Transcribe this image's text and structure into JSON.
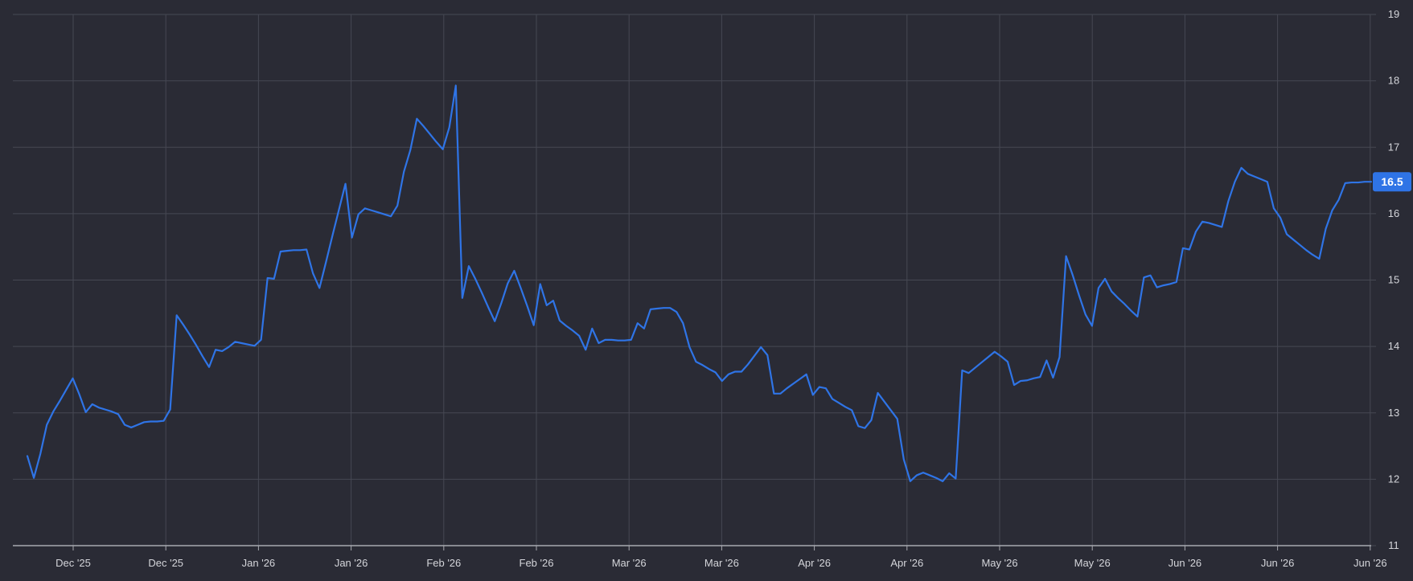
{
  "colors": {
    "background": "#2a2b35",
    "grid": "#464853",
    "axis": "#a8a9b0",
    "tick_text": "#d4d5da",
    "series": "#2f74e6",
    "badge_bg": "#2f74e6",
    "badge_text": "#ffffff"
  },
  "chart_data": {
    "type": "line",
    "title": "",
    "xlabel": "",
    "ylabel": "",
    "grid": true,
    "y_axis_position": "right",
    "ylim": [
      11,
      19
    ],
    "y_ticks": [
      11,
      12,
      13,
      14,
      15,
      16,
      17,
      18,
      19
    ],
    "x_tick_labels": [
      "Dec '25",
      "Dec '25",
      "Jan '26",
      "Jan '26",
      "Feb '26",
      "Feb '26",
      "Mar '26",
      "Mar '26",
      "Apr '26",
      "Apr '26",
      "May '26",
      "May '26",
      "Jun '26",
      "Jun '26",
      "Jun '26"
    ],
    "last_value_label": "16.5",
    "series": [
      {
        "values": [
          12.35,
          12.02,
          12.38,
          12.82,
          13.02,
          13.18,
          13.35,
          13.52,
          13.28,
          13.01,
          13.13,
          13.08,
          13.05,
          13.02,
          12.98,
          12.82,
          12.78,
          12.82,
          12.86,
          12.87,
          12.87,
          12.88,
          13.05,
          14.47,
          14.33,
          14.18,
          14.02,
          13.85,
          13.69,
          13.95,
          13.93,
          13.99,
          14.07,
          14.05,
          14.03,
          14.01,
          14.1,
          15.03,
          15.02,
          15.43,
          15.44,
          15.45,
          15.45,
          15.46,
          15.1,
          14.88,
          15.27,
          15.67,
          16.06,
          16.45,
          15.64,
          15.99,
          16.08,
          16.05,
          16.02,
          15.99,
          15.96,
          16.12,
          16.63,
          16.96,
          17.43,
          17.32,
          17.2,
          17.08,
          16.97,
          17.3,
          17.93,
          14.73,
          15.21,
          15.02,
          14.81,
          14.59,
          14.38,
          14.65,
          14.95,
          15.14,
          14.88,
          14.61,
          14.32,
          14.94,
          14.62,
          14.69,
          14.39,
          14.31,
          14.24,
          14.16,
          13.95,
          14.27,
          14.05,
          14.1,
          14.1,
          14.09,
          14.09,
          14.1,
          14.35,
          14.27,
          14.56,
          14.57,
          14.58,
          14.58,
          14.52,
          14.35,
          13.99,
          13.77,
          13.72,
          13.66,
          13.61,
          13.48,
          13.58,
          13.62,
          13.62,
          13.73,
          13.86,
          13.99,
          13.87,
          13.29,
          13.29,
          13.37,
          13.44,
          13.51,
          13.58,
          13.27,
          13.39,
          13.37,
          13.21,
          13.15,
          13.09,
          13.04,
          12.8,
          12.77,
          12.89,
          13.3,
          13.17,
          13.04,
          12.91,
          12.3,
          11.97,
          12.06,
          12.1,
          12.06,
          12.02,
          11.97,
          12.09,
          12.01,
          13.64,
          13.6,
          13.68,
          13.76,
          13.84,
          13.92,
          13.85,
          13.77,
          13.42,
          13.48,
          13.49,
          13.52,
          13.54,
          13.79,
          13.53,
          13.84,
          15.36,
          15.08,
          14.77,
          14.48,
          14.31,
          14.88,
          15.02,
          14.83,
          14.73,
          14.64,
          14.54,
          14.45,
          15.04,
          15.07,
          14.89,
          14.92,
          14.94,
          14.97,
          15.48,
          15.46,
          15.73,
          15.88,
          15.86,
          15.83,
          15.8,
          16.19,
          16.48,
          16.69,
          16.6,
          16.56,
          16.52,
          16.48,
          16.08,
          15.94,
          15.69,
          15.61,
          15.53,
          15.45,
          15.38,
          15.32,
          15.77,
          16.05,
          16.21,
          16.46,
          16.47,
          16.47,
          16.48,
          16.48
        ]
      }
    ]
  }
}
